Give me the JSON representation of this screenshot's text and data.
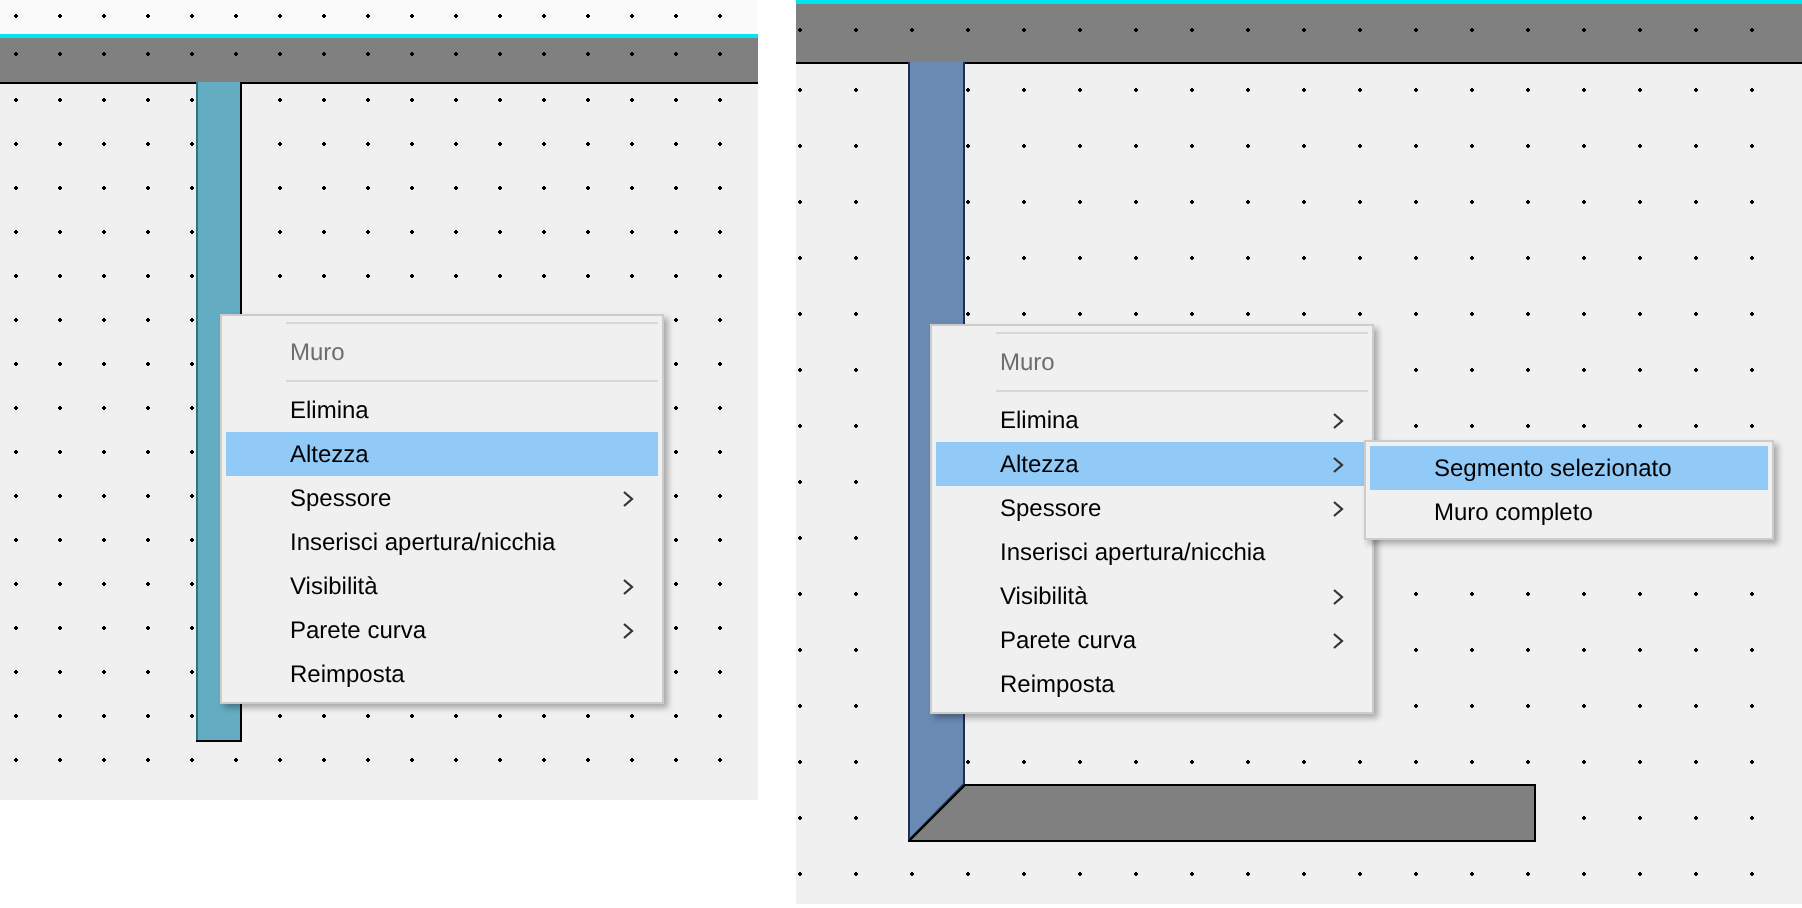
{
  "panels": [
    {
      "menu": {
        "header": "Muro",
        "items": [
          {
            "label": "Elimina",
            "selected": false,
            "has_submenu": false
          },
          {
            "label": "Altezza",
            "selected": true,
            "has_submenu": false
          },
          {
            "label": "Spessore",
            "selected": false,
            "has_submenu": true
          },
          {
            "label": "Inserisci apertura/nicchia",
            "selected": false,
            "has_submenu": false
          },
          {
            "label": "Visibilità",
            "selected": false,
            "has_submenu": true
          },
          {
            "label": "Parete curva",
            "selected": false,
            "has_submenu": true
          },
          {
            "label": "Reimposta",
            "selected": false,
            "has_submenu": false
          }
        ]
      }
    },
    {
      "menu": {
        "header": "Muro",
        "items": [
          {
            "label": "Elimina",
            "selected": false,
            "has_submenu": true
          },
          {
            "label": "Altezza",
            "selected": true,
            "has_submenu": true
          },
          {
            "label": "Spessore",
            "selected": false,
            "has_submenu": true
          },
          {
            "label": "Inserisci apertura/nicchia",
            "selected": false,
            "has_submenu": false
          },
          {
            "label": "Visibilità",
            "selected": false,
            "has_submenu": true
          },
          {
            "label": "Parete curva",
            "selected": false,
            "has_submenu": true
          },
          {
            "label": "Reimposta",
            "selected": false,
            "has_submenu": false
          }
        ]
      },
      "submenu": {
        "items": [
          {
            "label": "Segmento selezionato",
            "selected": true
          },
          {
            "label": "Muro completo",
            "selected": false
          }
        ]
      }
    }
  ]
}
